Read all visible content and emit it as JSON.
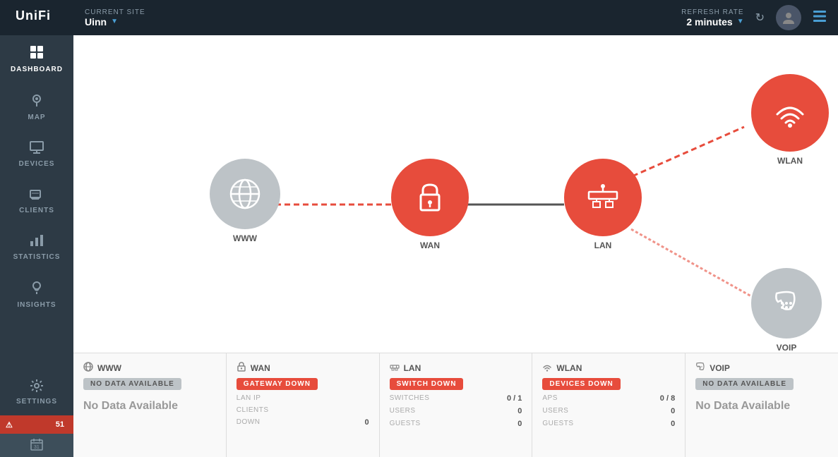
{
  "sidebar": {
    "logo": "UniFi",
    "items": [
      {
        "id": "dashboard",
        "label": "DASHBOARD",
        "icon": "⊞",
        "active": true
      },
      {
        "id": "map",
        "label": "MAP",
        "icon": "◉"
      },
      {
        "id": "devices",
        "label": "DEVICES",
        "icon": "🖥"
      },
      {
        "id": "clients",
        "label": "CLIENTS",
        "icon": "🖳"
      },
      {
        "id": "statistics",
        "label": "STATISTICS",
        "icon": "📊"
      },
      {
        "id": "insights",
        "label": "INSIGHTS",
        "icon": "💡"
      }
    ],
    "settings": {
      "label": "SETTINGS",
      "icon": "⚙"
    },
    "alerts": {
      "count": "51",
      "icon": "⚠"
    },
    "calendar": {
      "value": "31"
    }
  },
  "header": {
    "site_label": "CURRENT SITE",
    "site_name": "Uinn",
    "refresh_label": "REFRESH RATE",
    "refresh_value": "2 minutes"
  },
  "nodes": {
    "www": {
      "label": "WWW"
    },
    "wan": {
      "label": "WAN"
    },
    "lan": {
      "label": "LAN"
    },
    "wlan": {
      "label": "WLAN"
    },
    "voip": {
      "label": "VOIP"
    }
  },
  "cards": [
    {
      "id": "www",
      "icon": "🌐",
      "title": "WWW",
      "status": "NO DATA AVAILABLE",
      "status_type": "gray",
      "no_data": true,
      "no_data_text": "No Data Available",
      "stats": []
    },
    {
      "id": "wan",
      "icon": "🔒",
      "title": "WAN",
      "status": "GATEWAY DOWN",
      "status_type": "red",
      "no_data": false,
      "stats": [
        {
          "label": "LAN IP",
          "value": ""
        },
        {
          "label": "CLIENTS",
          "value": ""
        },
        {
          "label": "DOWN",
          "value": "0"
        }
      ]
    },
    {
      "id": "lan",
      "icon": "🖧",
      "title": "LAN",
      "status": "SWITCH DOWN",
      "status_type": "red",
      "no_data": false,
      "stats": [
        {
          "label": "SWITCHES",
          "value": "0 / 1"
        },
        {
          "label": "USERS",
          "value": "0"
        },
        {
          "label": "GUESTS",
          "value": "0"
        }
      ]
    },
    {
      "id": "wlan",
      "icon": "📶",
      "title": "WLAN",
      "status": "DEVICES DOWN",
      "status_type": "red",
      "no_data": false,
      "stats": [
        {
          "label": "APS",
          "value": "0 / 8"
        },
        {
          "label": "USERS",
          "value": "0"
        },
        {
          "label": "GUESTS",
          "value": "0"
        }
      ]
    },
    {
      "id": "voip",
      "icon": "☎",
      "title": "VOIP",
      "status": "NO DATA AVAILABLE",
      "status_type": "gray",
      "no_data": true,
      "no_data_text": "No Data Available",
      "stats": []
    }
  ]
}
